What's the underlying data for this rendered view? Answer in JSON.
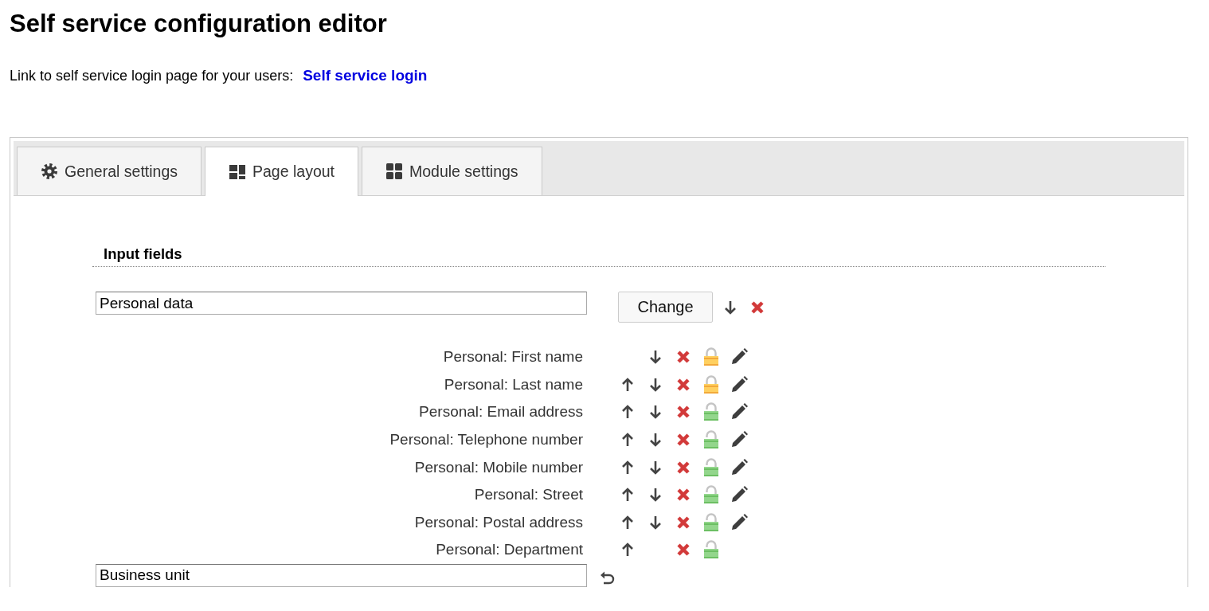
{
  "title": "Self service configuration editor",
  "intro": {
    "text": "Link to self service login page for your users:",
    "link": "Self service login"
  },
  "tabs": [
    {
      "label": "General settings",
      "kind": "gear",
      "selected": false
    },
    {
      "label": "Page layout",
      "kind": "layout",
      "selected": true
    },
    {
      "label": "Module settings",
      "kind": "grid",
      "selected": false
    }
  ],
  "section": {
    "title": "Input fields",
    "group": {
      "value": "Personal data",
      "button": "Change",
      "move_down": true,
      "removable": true
    },
    "fields": [
      {
        "label": "Personal: First name",
        "move_up": false,
        "move_down": true,
        "removable": true,
        "locked": true,
        "editable": true
      },
      {
        "label": "Personal: Last name",
        "move_up": true,
        "move_down": true,
        "removable": true,
        "locked": true,
        "editable": true
      },
      {
        "label": "Personal: Email address",
        "move_up": true,
        "move_down": true,
        "removable": true,
        "locked": false,
        "editable": true
      },
      {
        "label": "Personal: Telephone number",
        "move_up": true,
        "move_down": true,
        "removable": true,
        "locked": false,
        "editable": true
      },
      {
        "label": "Personal: Mobile number",
        "move_up": true,
        "move_down": true,
        "removable": true,
        "locked": false,
        "editable": true
      },
      {
        "label": "Personal: Street",
        "move_up": true,
        "move_down": true,
        "removable": true,
        "locked": false,
        "editable": true
      },
      {
        "label": "Personal: Postal address",
        "move_up": true,
        "move_down": true,
        "removable": true,
        "locked": false,
        "editable": true
      },
      {
        "label": "Personal: Department",
        "move_up": true,
        "move_down": false,
        "removable": true,
        "locked": false,
        "editable": false
      }
    ],
    "new_group": {
      "value": "Business unit",
      "undo": true
    }
  }
}
